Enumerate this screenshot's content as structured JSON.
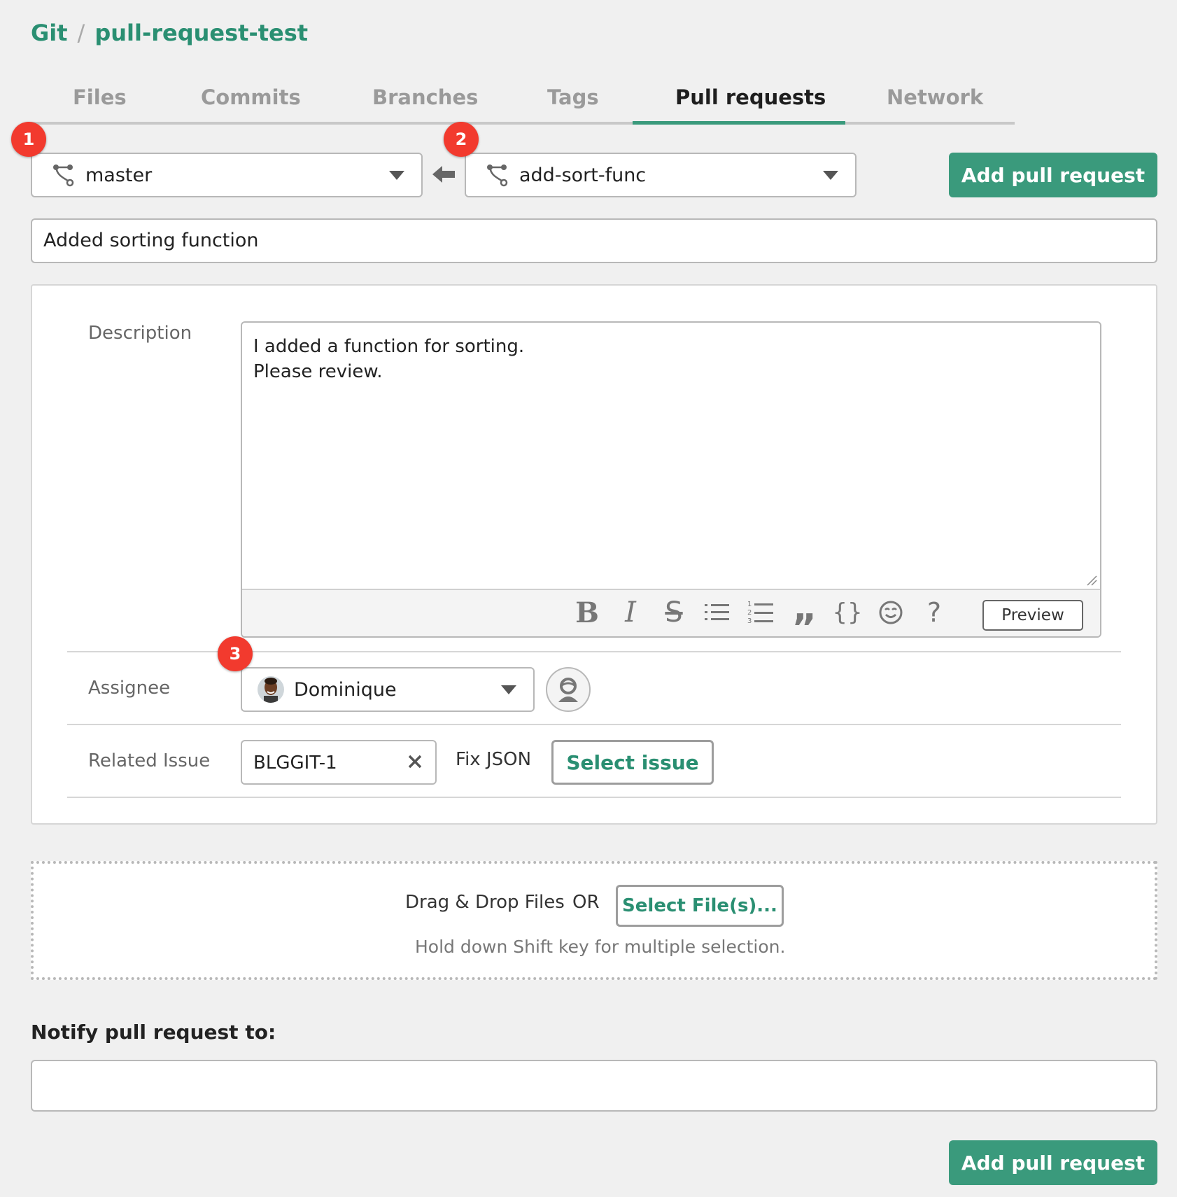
{
  "breadcrumb": {
    "root": "Git",
    "separator": "/",
    "repo": "pull-request-test"
  },
  "tabs": [
    {
      "label": "Files",
      "active": false
    },
    {
      "label": "Commits",
      "active": false
    },
    {
      "label": "Branches",
      "active": false
    },
    {
      "label": "Tags",
      "active": false
    },
    {
      "label": "Pull requests",
      "active": true
    },
    {
      "label": "Network",
      "active": false
    }
  ],
  "annotations": [
    "1",
    "2",
    "3"
  ],
  "branches": {
    "base": "master",
    "compare": "add-sort-func"
  },
  "buttons": {
    "add_pull_request": "Add pull request",
    "preview": "Preview",
    "select_issue": "Select issue",
    "select_files": "Select File(s)..."
  },
  "pull_request": {
    "title": "Added sorting function",
    "description_label": "Description",
    "description_line1": "I added a function for sorting.",
    "description_line2": "Please review."
  },
  "toolbar": {
    "bold": "B",
    "italic": "I",
    "strike": "S",
    "bullet_list": "☰",
    "numbered_list": "☰",
    "quote": "”",
    "code": "{}",
    "emoji": "☺",
    "help": "?"
  },
  "assignee": {
    "label": "Assignee",
    "name": "Dominique"
  },
  "related_issue": {
    "label": "Related Issue",
    "key": "BLGGIT-1",
    "title": "Fix JSON"
  },
  "dropzone": {
    "drag_text": "Drag & Drop Files",
    "or_text": "OR",
    "hint": "Hold down Shift key for multiple selection."
  },
  "notify": {
    "label": "Notify pull request to:",
    "value": ""
  },
  "colors": {
    "accent": "#3a9a7c",
    "link": "#2a8f72",
    "badge": "#f23a2e"
  }
}
